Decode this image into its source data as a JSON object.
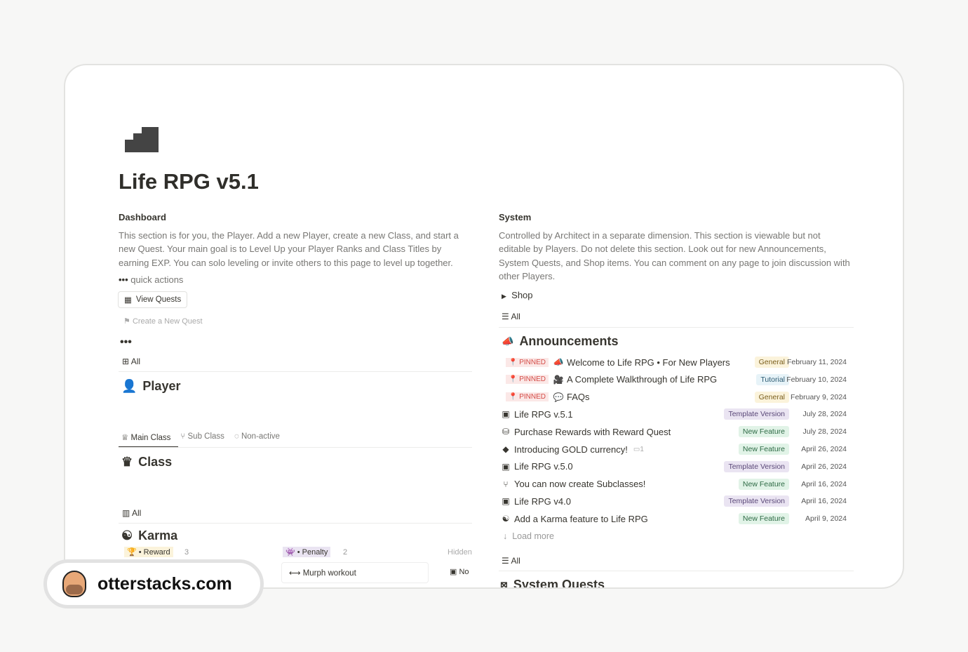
{
  "page": {
    "title": "Life RPG v5.1",
    "icon": "stairs-icon"
  },
  "dashboard": {
    "heading": "Dashboard",
    "description": "This section is for you, the Player. Add a new Player, create a new Class, and start a new Quest. Your main goal is to Level Up your Player Ranks and Class Titles by earning EXP. You can solo leveling or invite others to this page to level up together.",
    "quick_actions": "quick actions",
    "view_quests": "View Quests",
    "create_quest": "Create a New Quest",
    "all": "All",
    "player": "Player",
    "tabs": [
      "Main Class",
      "Sub Class",
      "Non-active"
    ],
    "class": "Class",
    "all2": "All",
    "karma": "Karma",
    "reward": "• Reward",
    "reward_count": "3",
    "penalty": "• Penalty",
    "penalty_count": "2",
    "hidden": "Hidden",
    "murph": "Murph workout",
    "no": "No"
  },
  "system": {
    "heading": "System",
    "description": "Controlled by Architect in a separate dimension. This section is viewable but not editable by Players. Do not delete this section. Look out for new Announcements, System Quests, and Shop items. You can comment on any page to join discussion with other Players.",
    "shop": "Shop",
    "all": "All",
    "announcements": "Announcements",
    "pinned_label": "PINNED",
    "items": [
      {
        "title": "Welcome to Life RPG • For New Players",
        "tag": "General",
        "date": "February 11, 2024",
        "pinned": true,
        "icon": "megaphone-icon"
      },
      {
        "title": "A Complete Walkthrough of Life RPG",
        "tag": "Tutorial",
        "date": "February 10, 2024",
        "pinned": true,
        "icon": "video-camera-icon"
      },
      {
        "title": "FAQs",
        "tag": "General",
        "date": "February 9, 2024",
        "pinned": true,
        "icon": "chat-bubbles-icon"
      },
      {
        "title": "Life RPG v.5.1",
        "tag": "Template Version",
        "date": "July 28, 2024",
        "icon": "chip-icon"
      },
      {
        "title": "Purchase Rewards with Reward Quest",
        "tag": "New Feature",
        "date": "July 28, 2024",
        "icon": "money-icon"
      },
      {
        "title": "Introducing GOLD currency!",
        "tag": "New Feature",
        "date": "April 26, 2024",
        "icon": "gem-icon",
        "comments": "1"
      },
      {
        "title": "Life RPG v.5.0",
        "tag": "Template Version",
        "date": "April 26, 2024",
        "icon": "chip-icon"
      },
      {
        "title": "You can now create Subclasses!",
        "tag": "New Feature",
        "date": "April 16, 2024",
        "icon": "branch-icon"
      },
      {
        "title": "Life RPG v4.0",
        "tag": "Template Version",
        "date": "April 16, 2024",
        "icon": "chip-icon"
      },
      {
        "title": "Add a Karma feature to Life RPG",
        "tag": "New Feature",
        "date": "April 9, 2024",
        "icon": "yin-yang-icon"
      }
    ],
    "load_more": "Load more",
    "all2": "All",
    "system_quests": "System Quests"
  },
  "tag_colors": {
    "General": "#fbf3db",
    "Tutorial": "#e7f3f8",
    "Template Version": "#eae4f2",
    "New Feature": "#e1f3e7"
  },
  "tag_text": {
    "General": "#7a5e1c",
    "Tutorial": "#2b5a72",
    "Template Version": "#5a4878",
    "New Feature": "#2d6a45"
  },
  "watermark": {
    "text": "otterstacks.com"
  }
}
